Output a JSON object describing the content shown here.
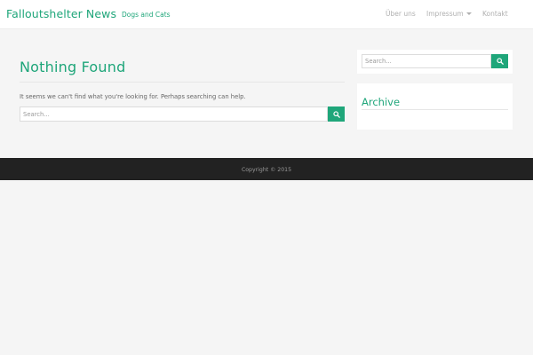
{
  "header": {
    "brand": "Falloutshelter News",
    "tagline": "Dogs and Cats",
    "nav": {
      "about": "Über uns",
      "impressum": "Impressum",
      "kontakt": "Kontakt"
    }
  },
  "main": {
    "title": "Nothing Found",
    "message": "It seems we can't find what you're looking for. Perhaps searching can help.",
    "search": {
      "placeholder": "Search...",
      "value": ""
    }
  },
  "sidebar": {
    "search": {
      "placeholder": "Search...",
      "value": ""
    },
    "archive_title": "Archive"
  },
  "footer": {
    "copyright": "Copyright © 2015"
  },
  "icons": {
    "search": "search-icon",
    "caret": "caret-down-icon"
  },
  "colors": {
    "accent": "#1fa67a",
    "background": "#f5f5f5",
    "footer": "#222222"
  }
}
